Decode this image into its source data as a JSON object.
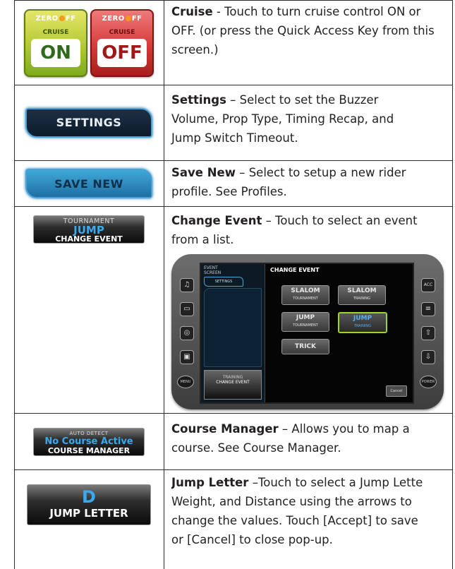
{
  "rows": [
    {
      "images": [
        {
          "brand": "ZERO",
          "brand2": "FF",
          "sub": "CRUISE",
          "big": "ON",
          "color": "#9fc52b"
        },
        {
          "brand": "ZERO",
          "brand2": "FF",
          "sub": "CRUISE",
          "big": "OFF",
          "color": "#d63a3a"
        }
      ],
      "title": "Cruise",
      "text_lines": [
        " - Touch to turn cruise control ON or",
        "OFF. (or press the Quick Access Key from this",
        "screen.)"
      ]
    },
    {
      "button": "SETTINGS",
      "title": "Settings",
      "text_lines": [
        " – Select to set the Buzzer",
        "Volume, Prop Type, Timing Recap, and",
        "Jump Switch Timeout."
      ]
    },
    {
      "button": "SAVE NEW",
      "title": "Save New",
      "text_lines": [
        " – Select to setup a new rider",
        "profile. See Profiles."
      ]
    },
    {
      "button": {
        "top": "TOURNAMENT",
        "mid": "JUMP",
        "bot": "CHANGE EVENT"
      },
      "title": "Change Event",
      "text_lines": [
        " – Touch to select an event",
        "from a list."
      ],
      "screen": {
        "header_lines": [
          "EVENT",
          "SCREEN"
        ],
        "settings": "SETTINGS",
        "training": "TRAINING",
        "change_event": "CHANGE EVENT",
        "panel_title": "CHANGE EVENT",
        "events": [
          {
            "name": "SLALOM",
            "sub": "TOURNAMENT",
            "selected": false
          },
          {
            "name": "SLALOM",
            "sub": "TRAINING",
            "selected": false
          },
          {
            "name": "JUMP",
            "sub": "TOURNAMENT",
            "selected": false
          },
          {
            "name": "JUMP",
            "sub": "TRAINING",
            "selected": true
          },
          {
            "name": "TRICK",
            "sub": "",
            "selected": false
          }
        ],
        "cancel": "Cancel",
        "left_buttons": [
          "♫",
          "▭",
          "◎",
          "▣"
        ],
        "right_buttons": [
          "ACC",
          "≡",
          "⇧",
          "⇩"
        ],
        "menu": "MENU",
        "power": "POWER"
      }
    },
    {
      "button": {
        "top": "AUTO DETECT",
        "mid": "No Course Active",
        "bot": "COURSE MANAGER"
      },
      "title": "Course Manager",
      "text_lines": [
        " – Allows you to map a",
        "course. See Course Manager."
      ]
    },
    {
      "button": {
        "mid": "D",
        "bot": "JUMP LETTER"
      },
      "title": "Jump Letter",
      "text_lines": [
        " –Touch to select a Jump Lette",
        "Weight, and Distance using the arrows to",
        "change the values. Touch [Accept] to save",
        "or [Cancel] to close pop-up."
      ]
    }
  ]
}
